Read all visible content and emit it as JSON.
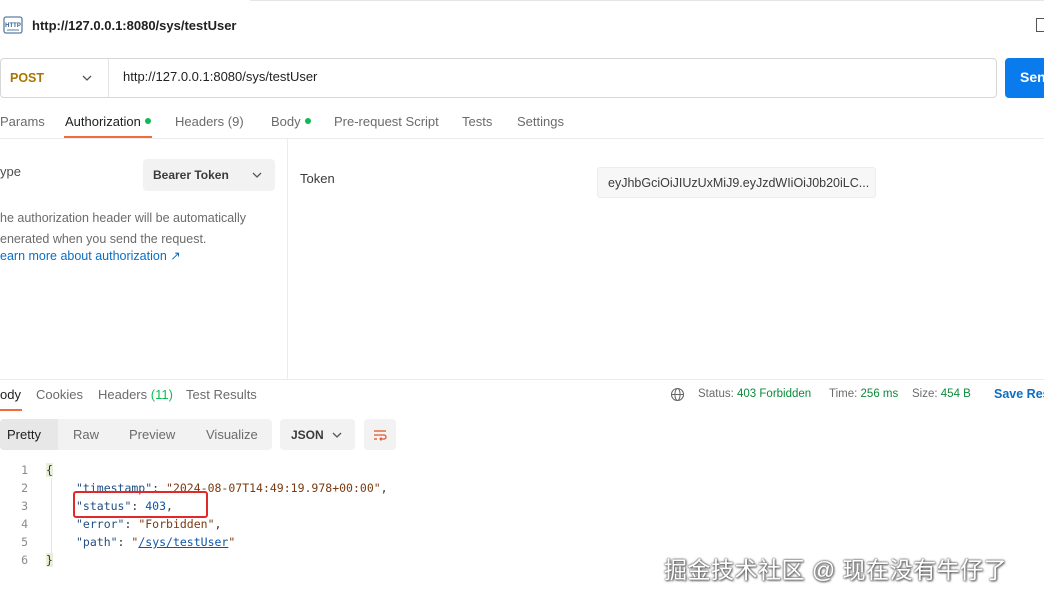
{
  "header": {
    "title": "http://127.0.0.1:8080/sys/testUser",
    "icon": "http-icon"
  },
  "request": {
    "method": "POST",
    "url": "http://127.0.0.1:8080/sys/testUser",
    "send_label": "Sen"
  },
  "request_tabs": {
    "params": "Params",
    "authorization": "Authorization",
    "headers": "Headers",
    "headers_count": "(9)",
    "body": "Body",
    "prerequest": "Pre-request Script",
    "tests": "Tests",
    "settings": "Settings"
  },
  "auth": {
    "type_label": "ype",
    "type_value": "Bearer Token",
    "description_line1": "he authorization header will be automatically",
    "description_line2": "enerated when you send the request.",
    "learn_more": "earn more about authorization ↗",
    "token_label": "Token",
    "token_value": "eyJhbGciOiJIUzUxMiJ9.eyJzdWIiOiJ0b20iLC..."
  },
  "response_tabs": {
    "body": "ody",
    "cookies": "Cookies",
    "headers": "Headers",
    "headers_count": "(11)",
    "test_results": "Test Results"
  },
  "response_meta": {
    "status_label": "Status:",
    "status_value": "403 Forbidden",
    "time_label": "Time:",
    "time_value": "256 ms",
    "size_label": "Size:",
    "size_value": "454 B",
    "save_label": "Save Res"
  },
  "view_modes": {
    "pretty": "Pretty",
    "raw": "Raw",
    "preview": "Preview",
    "visualize": "Visualize",
    "format": "JSON"
  },
  "code": {
    "line_numbers": [
      "1",
      "2",
      "3",
      "4",
      "5",
      "6"
    ],
    "open_brace": "{",
    "close_brace": "}",
    "timestamp_key": "\"timestamp\"",
    "timestamp_val": "\"2024-08-07T14:49:19.978+00:00\"",
    "status_key": "\"status\"",
    "status_val": "403",
    "error_key": "\"error\"",
    "error_val": "\"Forbidden\"",
    "path_key": "\"path\"",
    "path_val": "/sys/testUser"
  },
  "watermark": "掘金技术社区 @ 现在没有牛仔了",
  "colors": {
    "accent": "#f26b3a",
    "send": "#097bed",
    "status_ok": "#0cbb52",
    "highlight_box": "#e02a2a"
  }
}
